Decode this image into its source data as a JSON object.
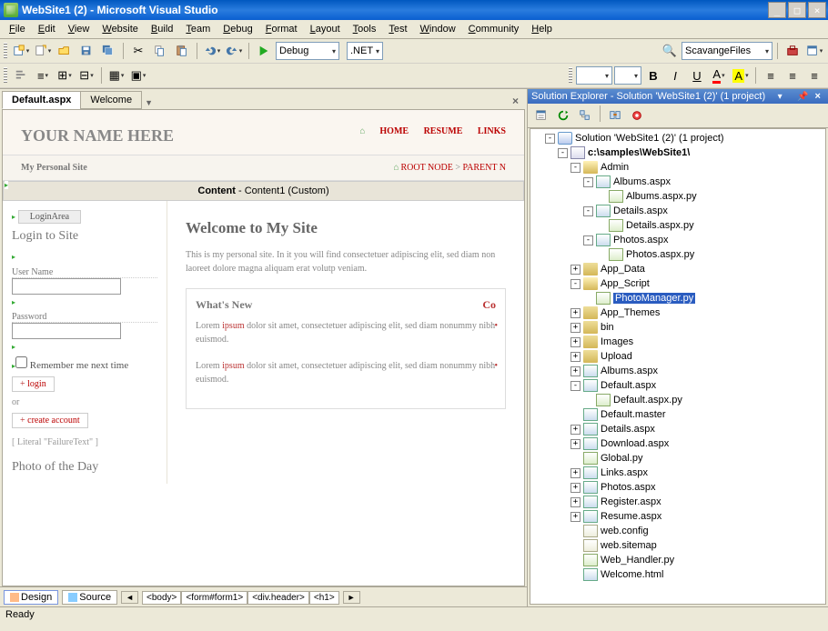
{
  "window": {
    "title": "WebSite1 (2) - Microsoft Visual Studio"
  },
  "menu": [
    "File",
    "Edit",
    "View",
    "Website",
    "Build",
    "Team",
    "Debug",
    "Format",
    "Layout",
    "Tools",
    "Test",
    "Window",
    "Community",
    "Help"
  ],
  "toolbar1": {
    "config": "Debug",
    "platform": ".NET",
    "find": "ScavangeFiles"
  },
  "doc_tabs": {
    "active": "Default.aspx",
    "other": "Welcome"
  },
  "designer": {
    "site_title": "YOUR NAME HERE",
    "nav": [
      "HOME",
      "RESUME",
      "LINKS"
    ],
    "breadcrumb_left": "My Personal Site",
    "breadcrumb_right_root": "ROOT NODE",
    "breadcrumb_right_parent": "PARENT N",
    "content_label_b": "Content",
    "content_label_rest": " - Content1 (Custom)",
    "login": {
      "area": "LoginArea",
      "heading": "Login to Site",
      "user_label": "User Name",
      "pass_label": "Password",
      "remember": "Remember me next time",
      "btn_login": "login",
      "or": "or",
      "btn_create": "create account",
      "literal": "[ Literal \"FailureText\" ]",
      "photo": "Photo of the Day"
    },
    "main": {
      "h1": "Welcome to My Site",
      "intro": "This is my personal site. In it you will find consectetuer adipiscing elit, sed diam non laoreet dolore magna aliquam erat volutp veniam.",
      "whatsnew_h": "What's New",
      "whatsnew_co": "Co",
      "p1a": "Lorem ",
      "p1b": "ipsum",
      "p1c": " dolor sit amet, consectetuer adipiscing elit, sed diam nonummy nibh euismod.",
      "p2a": "Lorem ",
      "p2b": "ipsum",
      "p2c": " dolor sit amet, consectetuer adipiscing elit, sed diam nonummy nibh euismod."
    }
  },
  "footer": {
    "design": "Design",
    "source": "Source",
    "crumbs": [
      "<body>",
      "<form#form1>",
      "<div.header>",
      "<h1>"
    ]
  },
  "solution": {
    "header": "Solution Explorer - Solution 'WebSite1 (2)' (1 project)",
    "root": "Solution 'WebSite1 (2)' (1 project)",
    "project": "c:\\samples\\WebSite1\\",
    "selected": "PhotoManager.py",
    "tree": [
      {
        "d": 1,
        "exp": "-",
        "ic": "sol",
        "t": "Solution 'WebSite1 (2)' (1 project)",
        "k": "root"
      },
      {
        "d": 2,
        "exp": "-",
        "ic": "prj",
        "t": "c:\\samples\\WebSite1\\",
        "bold": true,
        "k": "project"
      },
      {
        "d": 3,
        "exp": "-",
        "ic": "folder-open",
        "t": "Admin"
      },
      {
        "d": 4,
        "exp": "-",
        "ic": "aspx",
        "t": "Albums.aspx"
      },
      {
        "d": 5,
        "exp": "",
        "ic": "py",
        "t": "Albums.aspx.py"
      },
      {
        "d": 4,
        "exp": "-",
        "ic": "aspx",
        "t": "Details.aspx"
      },
      {
        "d": 5,
        "exp": "",
        "ic": "py",
        "t": "Details.aspx.py"
      },
      {
        "d": 4,
        "exp": "-",
        "ic": "aspx",
        "t": "Photos.aspx"
      },
      {
        "d": 5,
        "exp": "",
        "ic": "py",
        "t": "Photos.aspx.py"
      },
      {
        "d": 3,
        "exp": "+",
        "ic": "folder",
        "t": "App_Data"
      },
      {
        "d": 3,
        "exp": "-",
        "ic": "folder-open",
        "t": "App_Script"
      },
      {
        "d": 4,
        "exp": "",
        "ic": "py",
        "t": "PhotoManager.py",
        "sel": true,
        "k": "selected"
      },
      {
        "d": 3,
        "exp": "+",
        "ic": "folder",
        "t": "App_Themes"
      },
      {
        "d": 3,
        "exp": "+",
        "ic": "folder",
        "t": "bin"
      },
      {
        "d": 3,
        "exp": "+",
        "ic": "folder",
        "t": "Images"
      },
      {
        "d": 3,
        "exp": "+",
        "ic": "folder",
        "t": "Upload"
      },
      {
        "d": 3,
        "exp": "+",
        "ic": "aspx",
        "t": "Albums.aspx"
      },
      {
        "d": 3,
        "exp": "-",
        "ic": "aspx",
        "t": "Default.aspx"
      },
      {
        "d": 4,
        "exp": "",
        "ic": "py",
        "t": "Default.aspx.py"
      },
      {
        "d": 3,
        "exp": "",
        "ic": "aspx",
        "t": "Default.master"
      },
      {
        "d": 3,
        "exp": "+",
        "ic": "aspx",
        "t": "Details.aspx"
      },
      {
        "d": 3,
        "exp": "+",
        "ic": "aspx",
        "t": "Download.aspx"
      },
      {
        "d": 3,
        "exp": "",
        "ic": "py",
        "t": "Global.py"
      },
      {
        "d": 3,
        "exp": "+",
        "ic": "aspx",
        "t": "Links.aspx"
      },
      {
        "d": 3,
        "exp": "+",
        "ic": "aspx",
        "t": "Photos.aspx"
      },
      {
        "d": 3,
        "exp": "+",
        "ic": "aspx",
        "t": "Register.aspx"
      },
      {
        "d": 3,
        "exp": "+",
        "ic": "aspx",
        "t": "Resume.aspx"
      },
      {
        "d": 3,
        "exp": "",
        "ic": "config",
        "t": "web.config"
      },
      {
        "d": 3,
        "exp": "",
        "ic": "config",
        "t": "web.sitemap"
      },
      {
        "d": 3,
        "exp": "",
        "ic": "py",
        "t": "Web_Handler.py"
      },
      {
        "d": 3,
        "exp": "",
        "ic": "aspx",
        "t": "Welcome.html"
      }
    ]
  },
  "status": "Ready"
}
